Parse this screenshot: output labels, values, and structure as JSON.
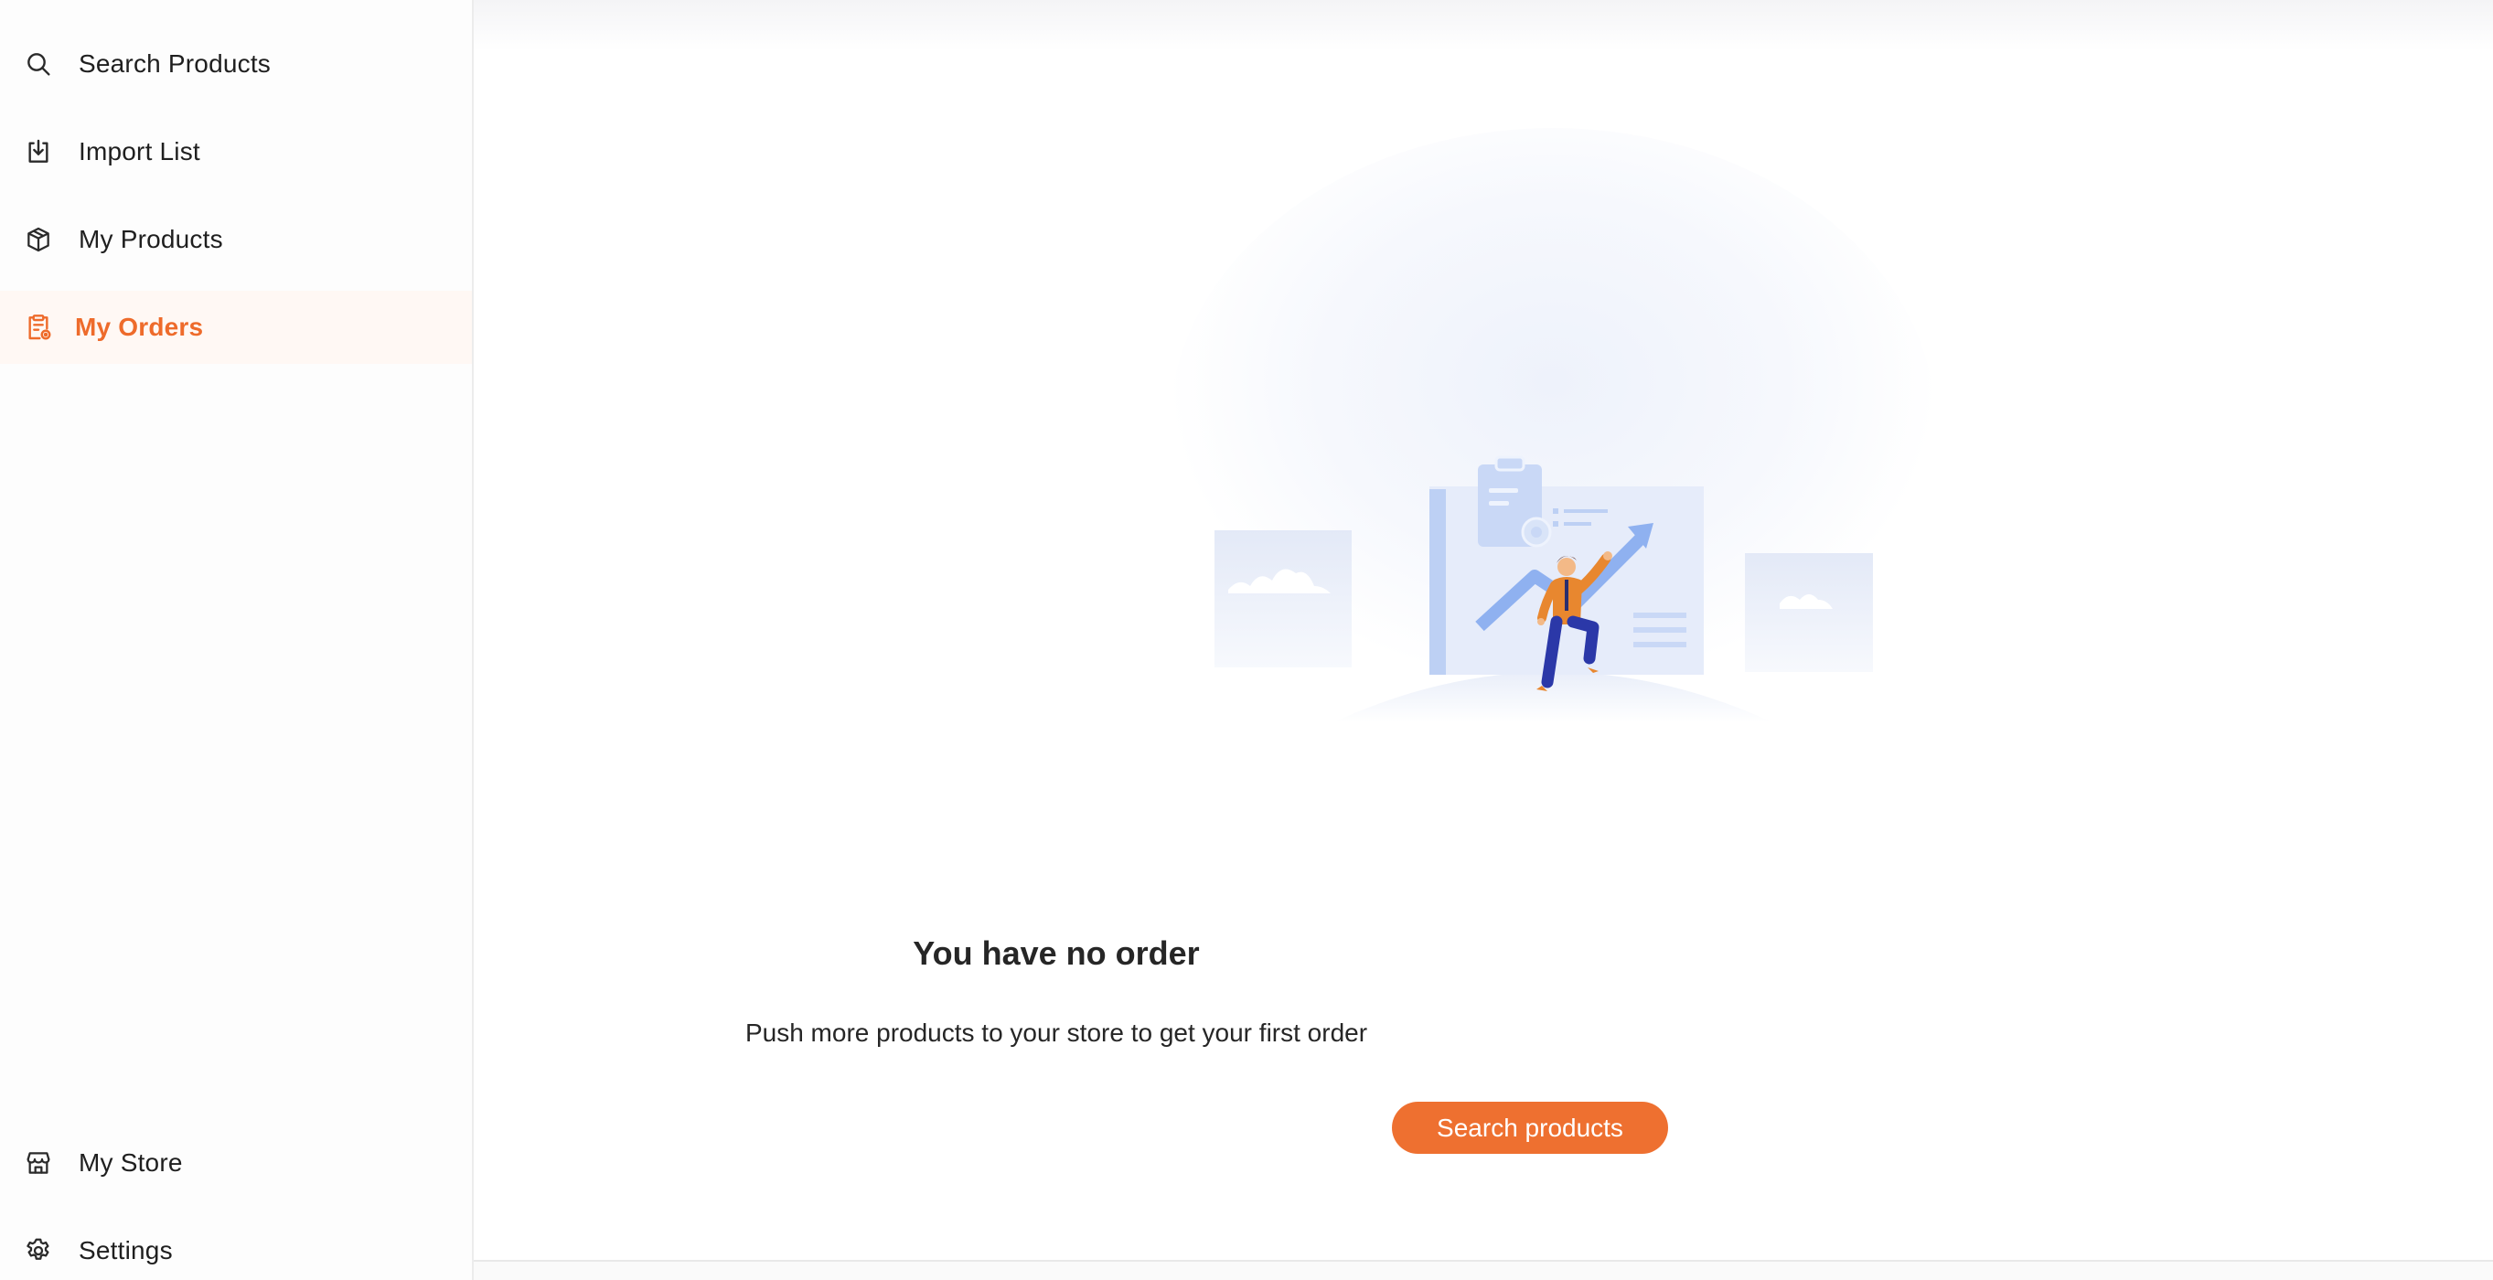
{
  "sidebar": {
    "items": [
      {
        "label": "Search Products",
        "icon": "search-icon"
      },
      {
        "label": "Import List",
        "icon": "download-tray-icon"
      },
      {
        "label": "My Products",
        "icon": "cube-icon"
      },
      {
        "label": "My Orders",
        "icon": "clipboard-icon",
        "active": true
      }
    ],
    "bottom_items": [
      {
        "label": "My Store",
        "icon": "storefront-icon"
      },
      {
        "label": "Settings",
        "icon": "gear-icon"
      }
    ]
  },
  "empty_state": {
    "title": "You have no order",
    "subtitle": "Push more products to your store to get your first order",
    "button_label": "Search products",
    "illustration": "growth-chart-illustration"
  },
  "colors": {
    "accent": "#ee7030",
    "active_bg": "#fff8f4",
    "text": "#1f1f1f",
    "illustration_blue": "#9db8f0"
  }
}
